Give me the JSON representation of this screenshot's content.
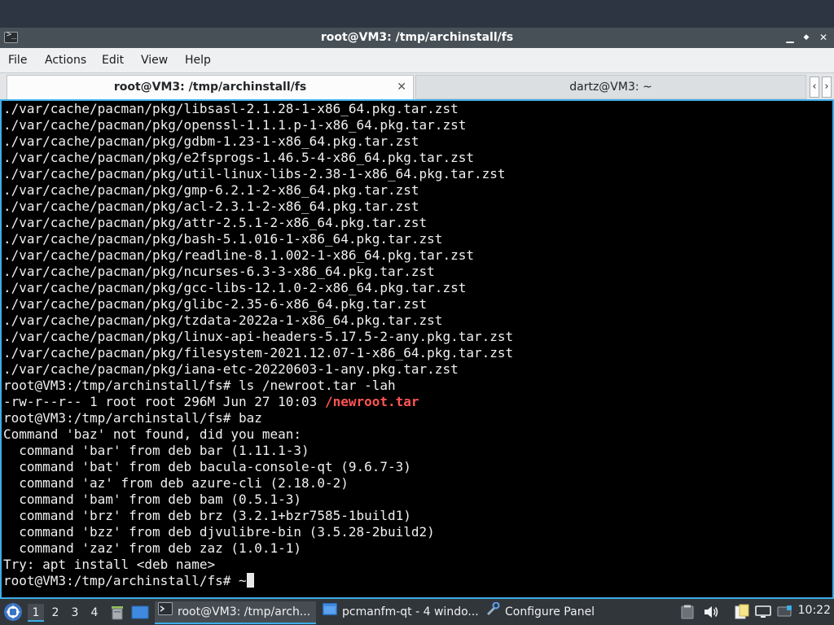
{
  "window": {
    "title": "root@VM3: /tmp/archinstall/fs",
    "app_icon_glyph": ">_",
    "controls": {
      "minimize": "▁",
      "maximize": "◆",
      "close": "✕"
    }
  },
  "menu": [
    "File",
    "Actions",
    "Edit",
    "View",
    "Help"
  ],
  "tabs": [
    {
      "label": "root@VM3: /tmp/archinstall/fs",
      "close": "✕",
      "active": true
    },
    {
      "label": "dartz@VM3: ~",
      "active": false
    }
  ],
  "tab_scroll": {
    "left": "‹",
    "right": "›"
  },
  "terminal": {
    "lines": [
      {
        "text": "./var/cache/pacman/pkg/libsasl-2.1.28-1-x86_64.pkg.tar.zst"
      },
      {
        "text": "./var/cache/pacman/pkg/openssl-1.1.1.p-1-x86_64.pkg.tar.zst"
      },
      {
        "text": "./var/cache/pacman/pkg/gdbm-1.23-1-x86_64.pkg.tar.zst"
      },
      {
        "text": "./var/cache/pacman/pkg/e2fsprogs-1.46.5-4-x86_64.pkg.tar.zst"
      },
      {
        "text": "./var/cache/pacman/pkg/util-linux-libs-2.38-1-x86_64.pkg.tar.zst"
      },
      {
        "text": "./var/cache/pacman/pkg/gmp-6.2.1-2-x86_64.pkg.tar.zst"
      },
      {
        "text": "./var/cache/pacman/pkg/acl-2.3.1-2-x86_64.pkg.tar.zst"
      },
      {
        "text": "./var/cache/pacman/pkg/attr-2.5.1-2-x86_64.pkg.tar.zst"
      },
      {
        "text": "./var/cache/pacman/pkg/bash-5.1.016-1-x86_64.pkg.tar.zst"
      },
      {
        "text": "./var/cache/pacman/pkg/readline-8.1.002-1-x86_64.pkg.tar.zst"
      },
      {
        "text": "./var/cache/pacman/pkg/ncurses-6.3-3-x86_64.pkg.tar.zst"
      },
      {
        "text": "./var/cache/pacman/pkg/gcc-libs-12.1.0-2-x86_64.pkg.tar.zst"
      },
      {
        "text": "./var/cache/pacman/pkg/glibc-2.35-6-x86_64.pkg.tar.zst"
      },
      {
        "text": "./var/cache/pacman/pkg/tzdata-2022a-1-x86_64.pkg.tar.zst"
      },
      {
        "text": "./var/cache/pacman/pkg/linux-api-headers-5.17.5-2-any.pkg.tar.zst"
      },
      {
        "text": "./var/cache/pacman/pkg/filesystem-2021.12.07-1-x86_64.pkg.tar.zst"
      },
      {
        "text": "./var/cache/pacman/pkg/iana-etc-20220603-1-any.pkg.tar.zst"
      },
      {
        "text": "root@VM3:/tmp/archinstall/fs# ls /newroot.tar -lah"
      },
      {
        "text": "-rw-r--r-- 1 root root 296M Jun 27 10:03 ",
        "highlight": "/newroot.tar"
      },
      {
        "text": "root@VM3:/tmp/archinstall/fs# baz"
      },
      {
        "text": "Command 'baz' not found, did you mean:"
      },
      {
        "text": "  command 'bar' from deb bar (1.11.1-3)"
      },
      {
        "text": "  command 'bat' from deb bacula-console-qt (9.6.7-3)"
      },
      {
        "text": "  command 'az' from deb azure-cli (2.18.0-2)"
      },
      {
        "text": "  command 'bam' from deb bam (0.5.1-3)"
      },
      {
        "text": "  command 'brz' from deb brz (3.2.1+bzr7585-1build1)"
      },
      {
        "text": "  command 'bzz' from deb djvulibre-bin (3.5.28-2build2)"
      },
      {
        "text": "  command 'zaz' from deb zaz (1.0.1-1)"
      },
      {
        "text": "Try: apt install <deb name>"
      },
      {
        "text": "root@VM3:/tmp/archinstall/fs# ~",
        "cursor": true
      }
    ],
    "highlight_color": "#ff5454",
    "focus_color": "#3daee9"
  },
  "taskbar": {
    "start_icon": "start-menu-icon",
    "workspaces": [
      {
        "label": "1",
        "active": true
      },
      {
        "label": "2",
        "active": false
      },
      {
        "label": "3",
        "active": false
      },
      {
        "label": "4",
        "active": false
      }
    ],
    "tasks": [
      {
        "label": "root@VM3: /tmp/arch...",
        "icon": "terminal-icon",
        "current": true
      },
      {
        "label": "pcmanfm-qt - 4 windo...",
        "icon": "folder-icon",
        "current": false
      },
      {
        "label": "Configure Panel",
        "icon": "panel-settings-icon",
        "current": false
      }
    ],
    "tray_icons": [
      "clipboard-icon",
      "volume-icon",
      "notes-icon",
      "display-icon",
      "network-icon"
    ],
    "clock": "10:22",
    "accent": "#3daee9"
  }
}
